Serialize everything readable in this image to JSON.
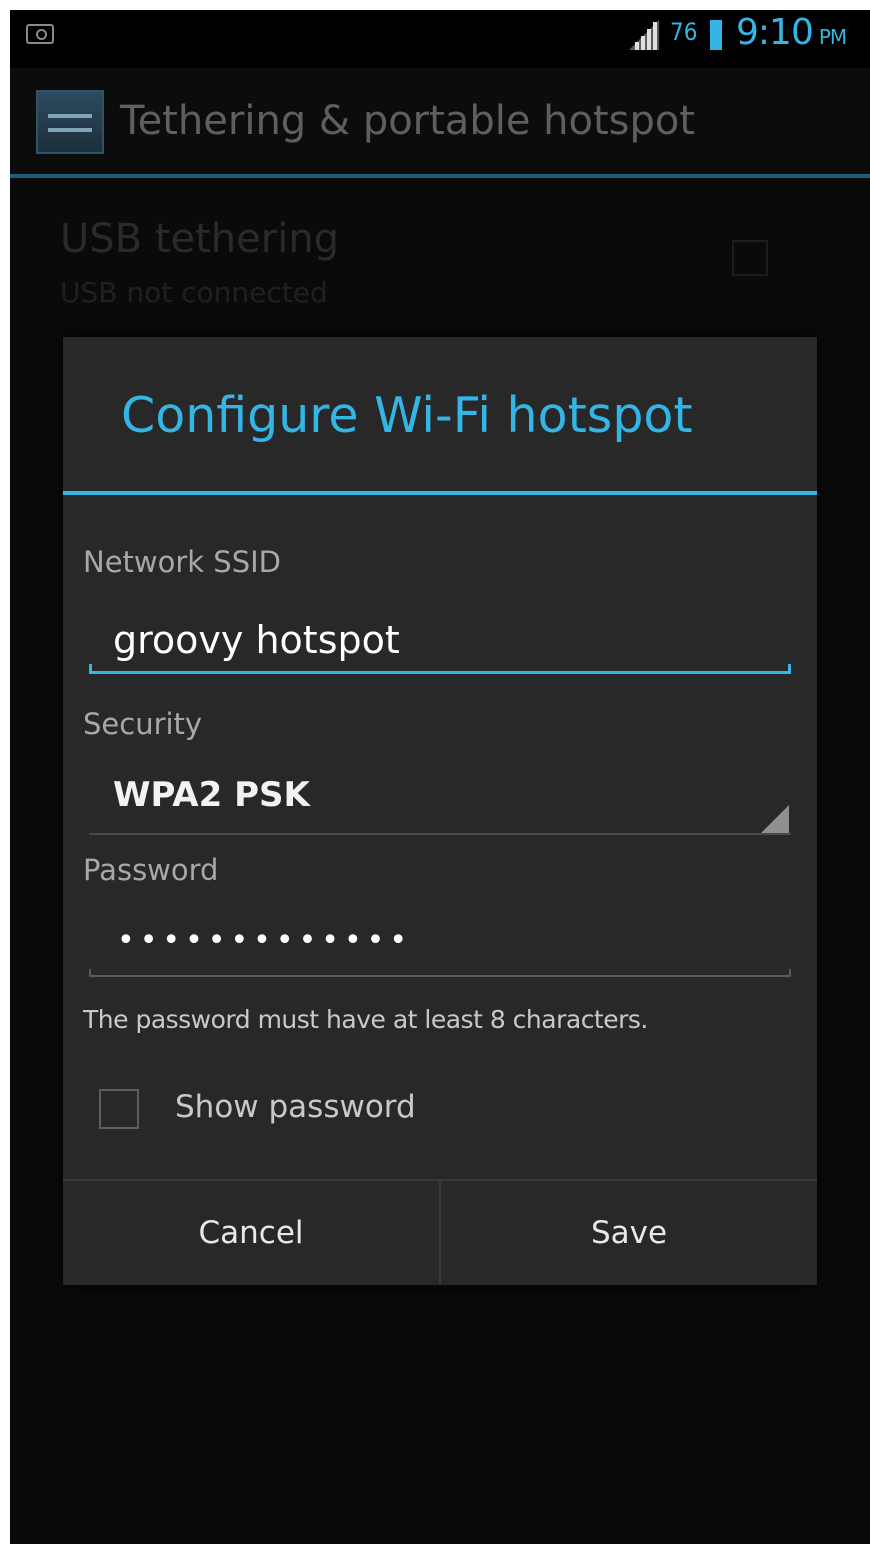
{
  "status_bar": {
    "battery_percent": "76",
    "time": "9:10",
    "ampm": "PM",
    "accent_color": "#33b5e5",
    "icons": [
      "screenshot-icon",
      "signal-icon",
      "battery-icon"
    ]
  },
  "action_bar": {
    "title": "Tethering & portable hotspot",
    "icon": "tethering-app-icon"
  },
  "background_list": {
    "usb_tethering": {
      "title": "USB tethering",
      "summary": "USB not connected"
    }
  },
  "dialog": {
    "title": "Configure Wi-Fi hotspot",
    "ssid": {
      "label": "Network SSID",
      "value": "groovy hotspot"
    },
    "security": {
      "label": "Security",
      "selected": "WPA2 PSK"
    },
    "password": {
      "label": "Password",
      "masked_value": "•••••••••••••",
      "hint": "The password must have at least 8 characters."
    },
    "show_password": {
      "label": "Show password",
      "checked": false
    },
    "buttons": {
      "cancel": "Cancel",
      "save": "Save"
    }
  }
}
